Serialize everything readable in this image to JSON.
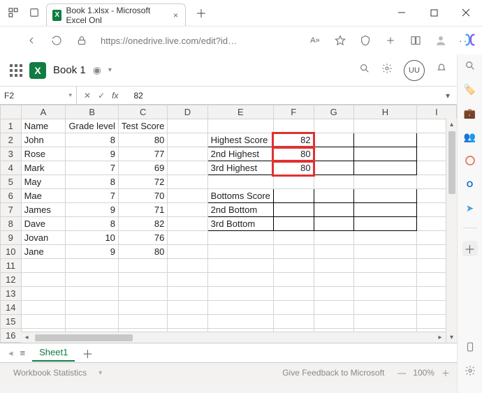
{
  "window": {
    "tab_title": "Book 1.xlsx - Microsoft Excel Onl",
    "url": "https://onedrive.live.com/edit?id…"
  },
  "excel_header": {
    "doc_name": "Book 1",
    "avatar_initials": "UU"
  },
  "formula_bar": {
    "name_box": "F2",
    "formula": "82"
  },
  "columns": [
    "A",
    "B",
    "C",
    "D",
    "E",
    "F",
    "G",
    "H",
    "I"
  ],
  "row_count": 17,
  "data": {
    "A1": "Name",
    "B1": "Grade level",
    "C1": "Test Score",
    "A2": "John",
    "B2": 8,
    "C2": 80,
    "A3": "Rose",
    "B3": 9,
    "C3": 77,
    "A4": "Mark",
    "B4": 7,
    "C4": 69,
    "A5": "May",
    "B5": 8,
    "C5": 72,
    "A6": "Mae",
    "B6": 7,
    "C6": 70,
    "A7": "James",
    "B7": 9,
    "C7": 71,
    "A8": "Dave",
    "B8": 8,
    "C8": 82,
    "A9": "Jovan",
    "B9": 10,
    "C9": 76,
    "A10": "Jane",
    "B10": 9,
    "C10": 80,
    "E2": "Highest Score",
    "F2": 82,
    "E3": "2nd Highest",
    "F3": 80,
    "E4": "3rd Highest",
    "F4": 80,
    "E6": "Bottoms Score",
    "E7": "2nd Bottom",
    "E8": "3rd Bottom"
  },
  "bordered_ranges": [
    [
      "E2",
      "F2",
      "G2",
      "H2"
    ],
    [
      "E3",
      "F3",
      "G3",
      "H3"
    ],
    [
      "E4",
      "F4",
      "G4",
      "H4"
    ],
    [
      "E6",
      "F6",
      "G6",
      "H6"
    ],
    [
      "E7",
      "F7",
      "G7",
      "H7"
    ],
    [
      "E8",
      "F8",
      "G8",
      "H8"
    ]
  ],
  "red_outline_cells": [
    "F2",
    "F3",
    "F4"
  ],
  "numeric_columns": [
    "B",
    "C",
    "F"
  ],
  "sheets": {
    "active": "Sheet1"
  },
  "status": {
    "workbook_stats": "Workbook Statistics",
    "feedback": "Give Feedback to Microsoft",
    "zoom": "100%"
  }
}
